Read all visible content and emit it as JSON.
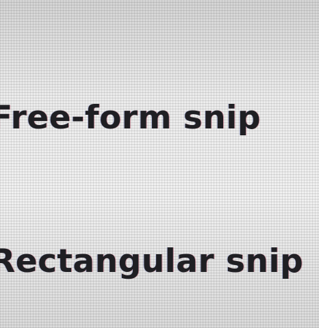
{
  "menu": {
    "items": [
      {
        "label": "Free-form snip"
      },
      {
        "label": "Rectangular snip"
      }
    ]
  }
}
